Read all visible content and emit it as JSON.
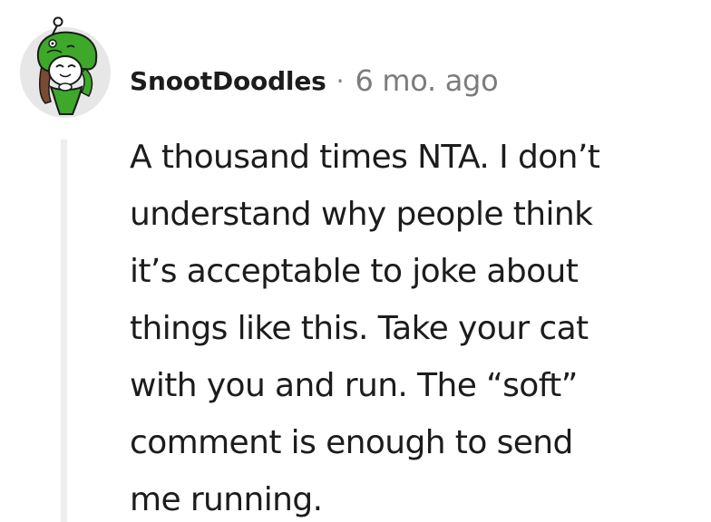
{
  "comment": {
    "author": "SnootDoodles",
    "separator": "·",
    "age": "6 mo. ago",
    "avatar_icon": "snoo-frog-hood-avatar-icon",
    "text_lines": [
      "A thousand times NTA. I don’t",
      "understand why people think",
      "it’s acceptable to joke about",
      "things like this. Take your cat",
      "with you and run. The “soft”",
      "comment is enough to send",
      "me running."
    ]
  },
  "colors": {
    "text": "#1c1c1c",
    "meta": "#7c7c7c",
    "thread_line": "#ededed",
    "avatar_green": "#3da829",
    "avatar_hair": "#7a4a33"
  }
}
